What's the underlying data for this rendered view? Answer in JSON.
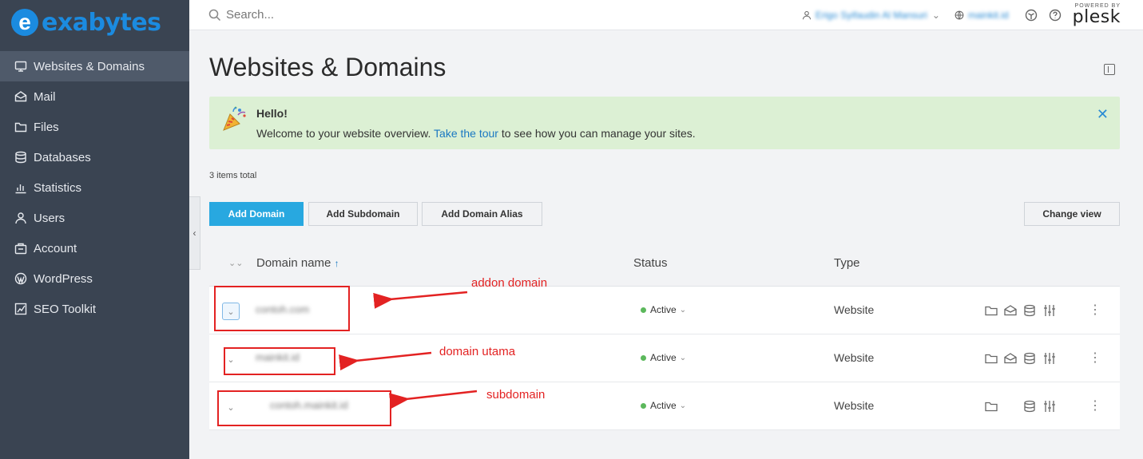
{
  "brand": {
    "logo_letter": "e",
    "name": "exabytes"
  },
  "search": {
    "placeholder": "Search..."
  },
  "topbar": {
    "user": "Erigo Syifaudin Al Mansuri",
    "domain": "mainkit.id",
    "powered_by": "POWERED BY",
    "plesk": "plesk"
  },
  "sidebar": {
    "items": [
      {
        "label": "Websites & Domains",
        "icon": "monitor-icon",
        "active": true
      },
      {
        "label": "Mail",
        "icon": "mail-icon"
      },
      {
        "label": "Files",
        "icon": "folder-icon"
      },
      {
        "label": "Databases",
        "icon": "database-icon"
      },
      {
        "label": "Statistics",
        "icon": "bar-chart-icon"
      },
      {
        "label": "Users",
        "icon": "user-icon"
      },
      {
        "label": "Account",
        "icon": "account-icon"
      },
      {
        "label": "WordPress",
        "icon": "wordpress-icon"
      },
      {
        "label": "SEO Toolkit",
        "icon": "seo-icon"
      }
    ]
  },
  "main": {
    "title": "Websites & Domains",
    "banner": {
      "hello": "Hello!",
      "text_before": "Welcome to your website overview.",
      "link": "Take the tour",
      "text_after": "to see how you can manage your sites."
    },
    "items_total": "3 items total",
    "buttons": {
      "add_domain": "Add Domain",
      "add_subdomain": "Add Subdomain",
      "add_alias": "Add Domain Alias",
      "change_view": "Change view"
    },
    "table": {
      "headers": {
        "domain": "Domain name",
        "sort_arrow": "↑",
        "status": "Status",
        "type": "Type"
      },
      "rows": [
        {
          "domain": "contoh.com",
          "status": "Active",
          "type": "Website"
        },
        {
          "domain": "mainkit.id",
          "status": "Active",
          "type": "Website"
        },
        {
          "domain": "contoh.mainkit.id",
          "status": "Active",
          "type": "Website"
        }
      ]
    }
  },
  "annotations": {
    "addon": "addon domain",
    "utama": "domain utama",
    "subdomain": "subdomain",
    "color": "#e32222"
  }
}
